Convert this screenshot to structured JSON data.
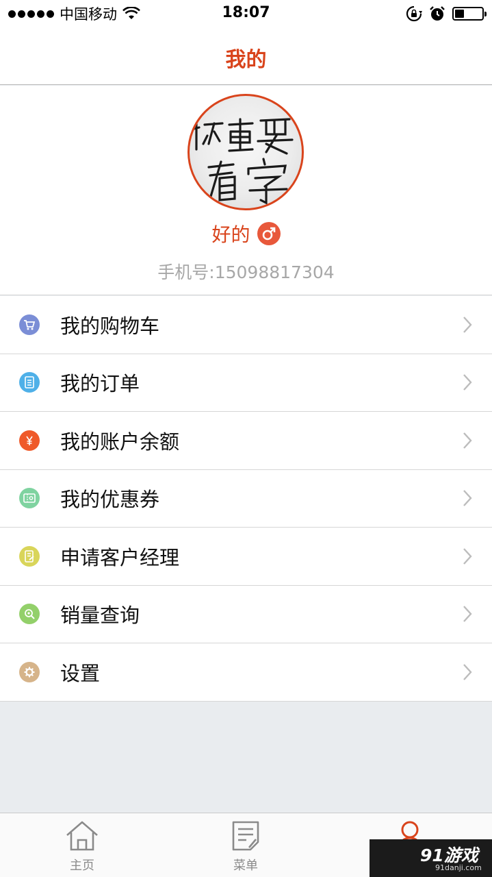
{
  "status_bar": {
    "carrier": "中国移动",
    "time": "18:07",
    "battery_level": 0.35
  },
  "nav": {
    "title": "我的"
  },
  "profile": {
    "avatar_text": "不重要看字",
    "nickname": "好的",
    "gender_icon": "male-symbol-icon",
    "phone": "手机号:15098817304"
  },
  "menu": [
    {
      "label": "我的购物车",
      "icon": "shopping-cart-icon",
      "color": "#7b8ed6"
    },
    {
      "label": "我的订单",
      "icon": "order-list-icon",
      "color": "#4fb0e8"
    },
    {
      "label": "我的账户余额",
      "icon": "yuan-icon",
      "color": "#ef5a2a"
    },
    {
      "label": "我的优惠券",
      "icon": "coupon-icon",
      "color": "#7fd3a0"
    },
    {
      "label": "申请客户经理",
      "icon": "apply-form-icon",
      "color": "#d9d55a"
    },
    {
      "label": "销量查询",
      "icon": "search-sales-icon",
      "color": "#93d06a"
    },
    {
      "label": "设置",
      "icon": "gear-icon",
      "color": "#d6b48a"
    }
  ],
  "tab_bar": {
    "tabs": [
      {
        "label": "主页",
        "icon": "home-icon"
      },
      {
        "label": "菜单",
        "icon": "menu-document-icon"
      },
      {
        "label": "",
        "icon": "profile-icon"
      }
    ],
    "active_color": "#d9441c"
  },
  "watermark": {
    "logo": "91游戏",
    "url": "91danji.com"
  },
  "colors": {
    "accent": "#d9441c",
    "background": "#e9ecef",
    "divider": "#d6d6d6"
  }
}
